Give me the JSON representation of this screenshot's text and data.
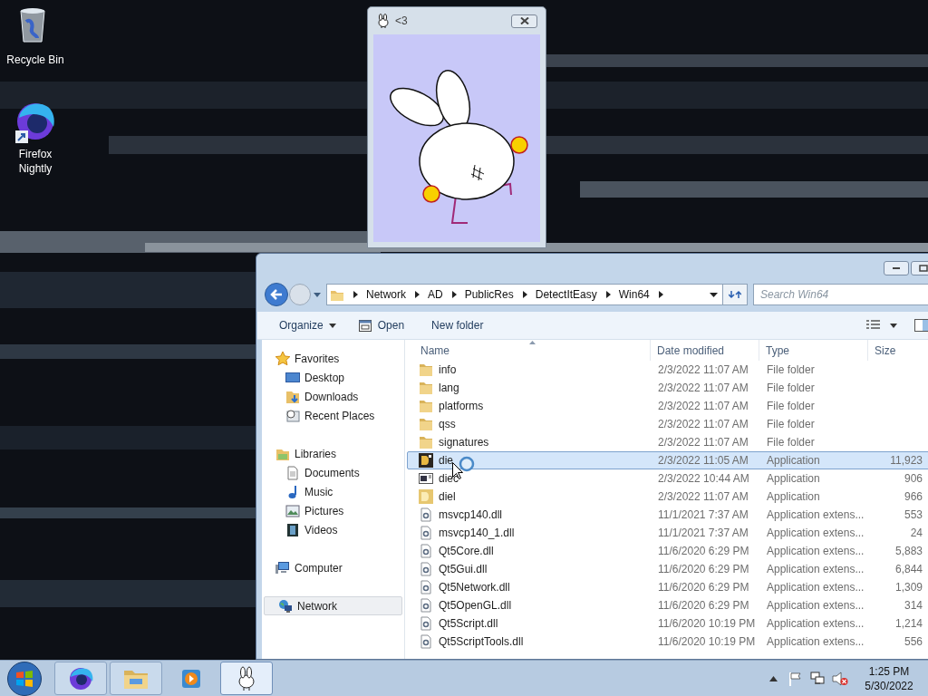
{
  "desktop_icons": [
    {
      "label": "Recycle Bin",
      "kind": "recycle"
    },
    {
      "label": "Firefox Nightly",
      "kind": "firefox"
    }
  ],
  "pet_window": {
    "title": "<3"
  },
  "explorer": {
    "breadcrumb": [
      "Network",
      "AD",
      "PublicRes",
      "DetectItEasy",
      "Win64"
    ],
    "search": {
      "placeholder": "Search Win64"
    },
    "toolbar": [
      {
        "label": "Organize",
        "kind": "menu"
      },
      {
        "label": "Open",
        "kind": "open"
      },
      {
        "label": "New folder",
        "kind": "plain"
      }
    ],
    "nav": [
      {
        "label": "Favorites",
        "kind": "favorites",
        "selected": false,
        "children": [
          {
            "label": "Desktop",
            "kind": "desktop",
            "selected": false
          },
          {
            "label": "Downloads",
            "kind": "downloads",
            "selected": false
          },
          {
            "label": "Recent Places",
            "kind": "recent",
            "selected": false
          }
        ]
      },
      {
        "label": "Libraries",
        "kind": "libraries",
        "selected": false,
        "children": [
          {
            "label": "Documents",
            "kind": "documents",
            "selected": false
          },
          {
            "label": "Music",
            "kind": "music",
            "selected": false
          },
          {
            "label": "Pictures",
            "kind": "pictures",
            "selected": false
          },
          {
            "label": "Videos",
            "kind": "videos",
            "selected": false
          }
        ]
      },
      {
        "label": "Computer",
        "kind": "computer",
        "selected": false
      },
      {
        "label": "Network",
        "kind": "network",
        "selected": true
      }
    ],
    "columns": [
      "Name",
      "Date modified",
      "Type",
      "Size"
    ],
    "rows": [
      {
        "name": "info",
        "date": "2/3/2022 11:07 AM",
        "type": "File folder",
        "kind": "folder",
        "selected": false
      },
      {
        "name": "lang",
        "date": "2/3/2022 11:07 AM",
        "type": "File folder",
        "kind": "folder",
        "selected": false
      },
      {
        "name": "platforms",
        "date": "2/3/2022 11:07 AM",
        "type": "File folder",
        "kind": "folder",
        "selected": false
      },
      {
        "name": "qss",
        "date": "2/3/2022 11:07 AM",
        "type": "File folder",
        "kind": "folder",
        "selected": false
      },
      {
        "name": "signatures",
        "date": "2/3/2022 11:07 AM",
        "type": "File folder",
        "kind": "folder",
        "selected": false
      },
      {
        "name": "die",
        "date": "2/3/2022 11:05 AM",
        "type": "Application",
        "size": "11,923",
        "kind": "app",
        "selected": true
      },
      {
        "name": "diec",
        "date": "2/3/2022 10:44 AM",
        "type": "Application",
        "size": "906",
        "kind": "console",
        "selected": false
      },
      {
        "name": "diel",
        "date": "2/3/2022 11:07 AM",
        "type": "Application",
        "size": "966",
        "kind": "app-light",
        "selected": false
      },
      {
        "name": "msvcp140.dll",
        "date": "11/1/2021 7:37 AM",
        "type": "Application extens...",
        "size": "553",
        "kind": "dll",
        "selected": false
      },
      {
        "name": "msvcp140_1.dll",
        "date": "11/1/2021 7:37 AM",
        "type": "Application extens...",
        "size": "24",
        "kind": "dll",
        "selected": false
      },
      {
        "name": "Qt5Core.dll",
        "date": "11/6/2020 6:29 PM",
        "type": "Application extens...",
        "size": "5,883",
        "kind": "dll",
        "selected": false
      },
      {
        "name": "Qt5Gui.dll",
        "date": "11/6/2020 6:29 PM",
        "type": "Application extens...",
        "size": "6,844",
        "kind": "dll",
        "selected": false
      },
      {
        "name": "Qt5Network.dll",
        "date": "11/6/2020 6:29 PM",
        "type": "Application extens...",
        "size": "1,309",
        "kind": "dll",
        "selected": false
      },
      {
        "name": "Qt5OpenGL.dll",
        "date": "11/6/2020 6:29 PM",
        "type": "Application extens...",
        "size": "314",
        "kind": "dll",
        "selected": false
      },
      {
        "name": "Qt5Script.dll",
        "date": "11/6/2020 10:19 PM",
        "type": "Application extens...",
        "size": "1,214",
        "kind": "dll",
        "selected": false
      },
      {
        "name": "Qt5ScriptTools.dll",
        "date": "11/6/2020 10:19 PM",
        "type": "Application extens...",
        "size": "556",
        "kind": "dll",
        "selected": false
      }
    ]
  },
  "taskbar": {
    "buttons": [
      {
        "kind": "firefox",
        "running": true,
        "selected": false
      },
      {
        "kind": "explorer",
        "running": true,
        "selected": false
      },
      {
        "kind": "media",
        "running": false,
        "selected": false
      },
      {
        "kind": "bunny",
        "running": true,
        "selected": true
      }
    ],
    "clock": {
      "time": "1:25 PM",
      "date": "5/30/2022"
    }
  }
}
